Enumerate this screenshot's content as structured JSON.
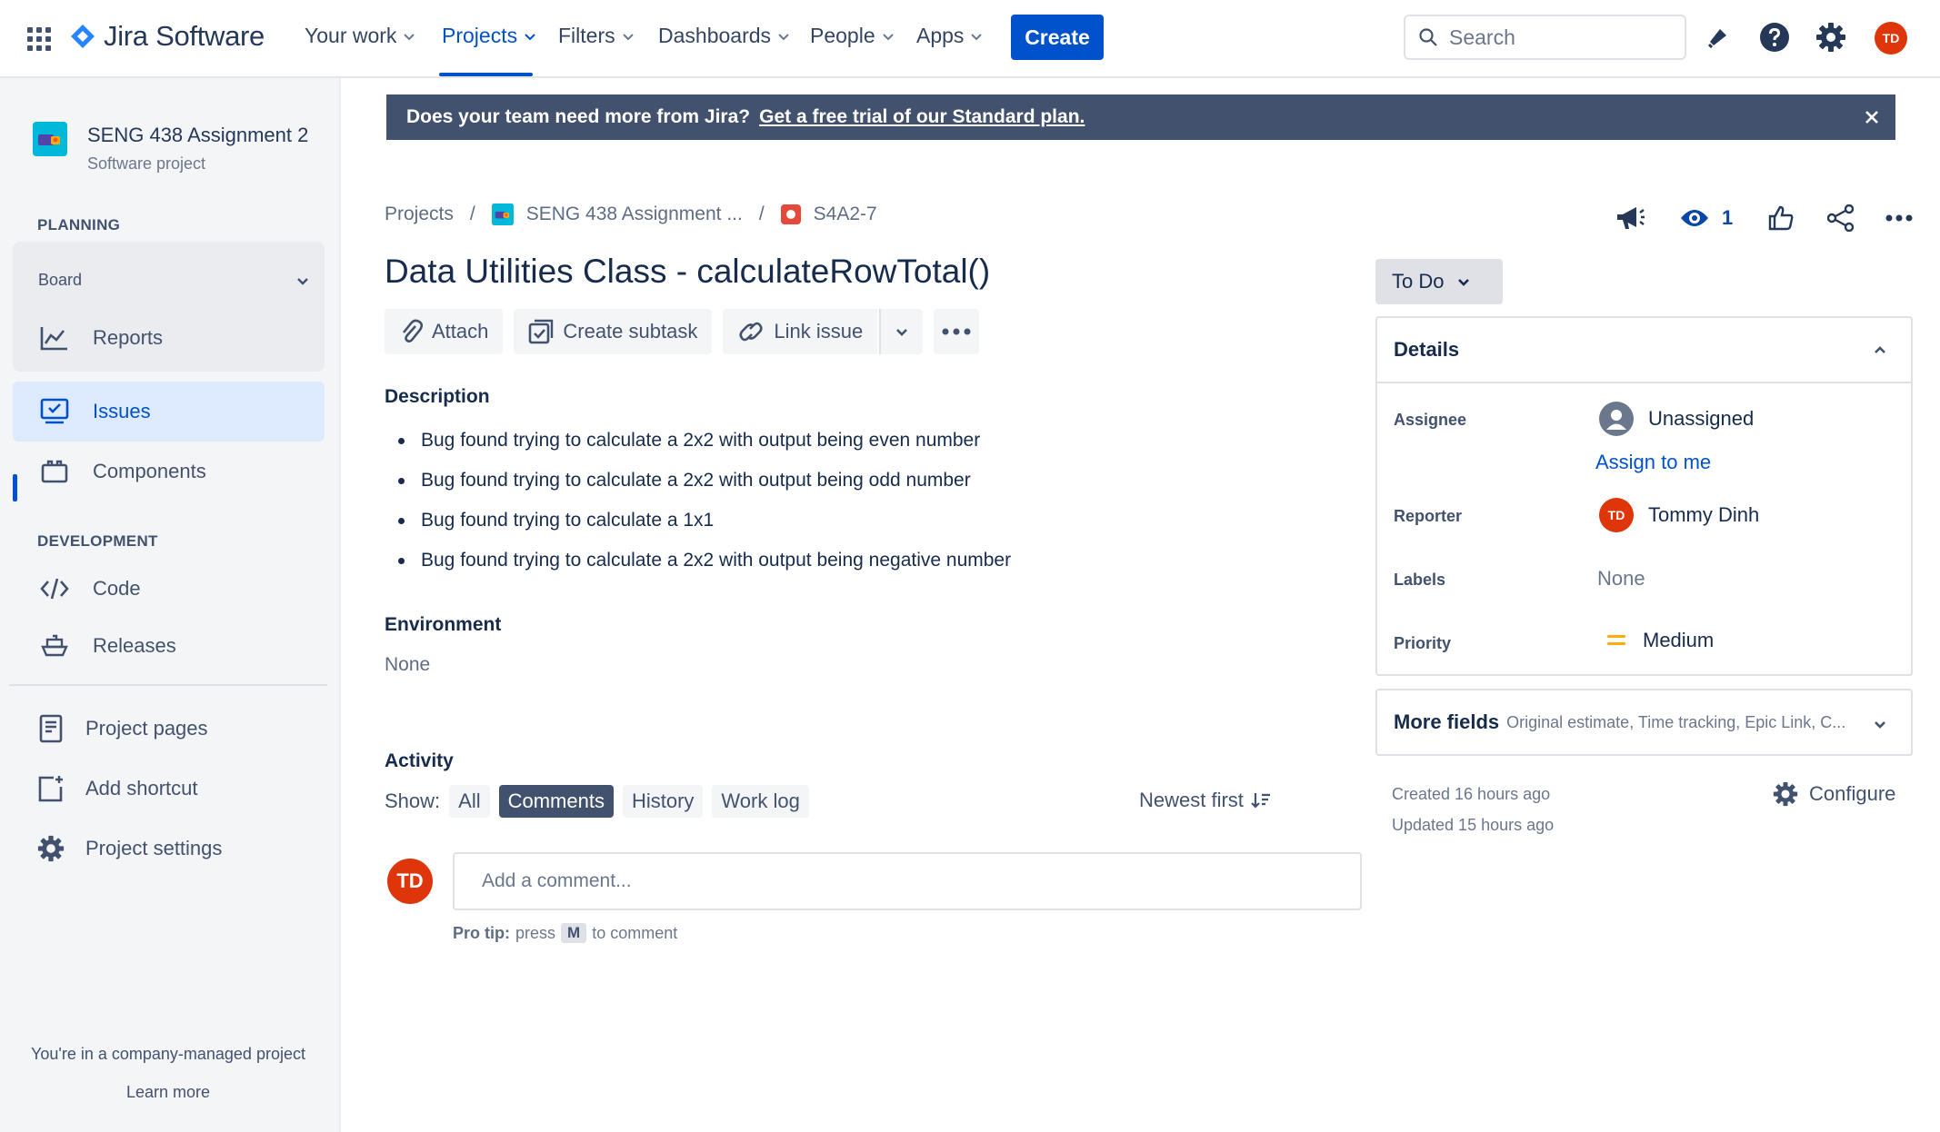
{
  "topnav": {
    "brand": "Jira Software",
    "items": [
      {
        "label": "Your work"
      },
      {
        "label": "Projects"
      },
      {
        "label": "Filters"
      },
      {
        "label": "Dashboards"
      },
      {
        "label": "People"
      },
      {
        "label": "Apps"
      }
    ],
    "active_item": "Projects",
    "create_label": "Create",
    "search_placeholder": "Search",
    "user_initials": "TD",
    "accent_color": "#0052cc"
  },
  "sidebar": {
    "project_name": "SENG 438 Assignment 2",
    "project_type": "Software project",
    "planning_header": "PLANNING",
    "board_label": "Board",
    "reports_label": "Reports",
    "issues_label": "Issues",
    "components_label": "Components",
    "development_header": "DEVELOPMENT",
    "code_label": "Code",
    "releases_label": "Releases",
    "project_pages_label": "Project pages",
    "add_shortcut_label": "Add shortcut",
    "project_settings_label": "Project settings",
    "footer_text": "You're in a company-managed project",
    "learn_more": "Learn more"
  },
  "banner": {
    "text": "Does your team need more from Jira?",
    "link": "Get a free trial of our Standard plan."
  },
  "breadcrumb": {
    "projects": "Projects",
    "project": "SENG 438 Assignment ...",
    "issue_key": "S4A2-7"
  },
  "issue": {
    "title": "Data Utilities Class - calculateRowTotal()",
    "actions": {
      "attach": "Attach",
      "create_subtask": "Create subtask",
      "link_issue": "Link issue"
    },
    "description_label": "Description",
    "description_items": [
      "Bug found trying to calculate a 2x2 with output being even number",
      "Bug found trying to calculate a 2x2 with output being odd number",
      "Bug found trying to calculate a 1x1",
      "Bug found trying to calculate a 2x2 with output being negative number"
    ],
    "environment_label": "Environment",
    "environment_value": "None",
    "status": "To Do",
    "watchers": "1"
  },
  "activity": {
    "label": "Activity",
    "show_label": "Show:",
    "filters": [
      "All",
      "Comments",
      "History",
      "Work log"
    ],
    "selected_filter": "Comments",
    "sort_label": "Newest first",
    "comment_placeholder": "Add a comment...",
    "user_initials": "TD",
    "protip_bold": "Pro tip:",
    "protip_press": "press",
    "protip_key": "M",
    "protip_rest": "to comment"
  },
  "details": {
    "header": "Details",
    "assignee_label": "Assignee",
    "assignee_value": "Unassigned",
    "assign_to_me": "Assign to me",
    "reporter_label": "Reporter",
    "reporter_value": "Tommy Dinh",
    "reporter_initials": "TD",
    "labels_label": "Labels",
    "labels_value": "None",
    "priority_label": "Priority",
    "priority_value": "Medium",
    "priority_color": "#ffab00",
    "more_fields_title": "More fields",
    "more_fields_sub": "Original estimate, Time tracking, Epic Link, C...",
    "created": "Created 16 hours ago",
    "updated": "Updated 15 hours ago",
    "configure_label": "Configure"
  }
}
